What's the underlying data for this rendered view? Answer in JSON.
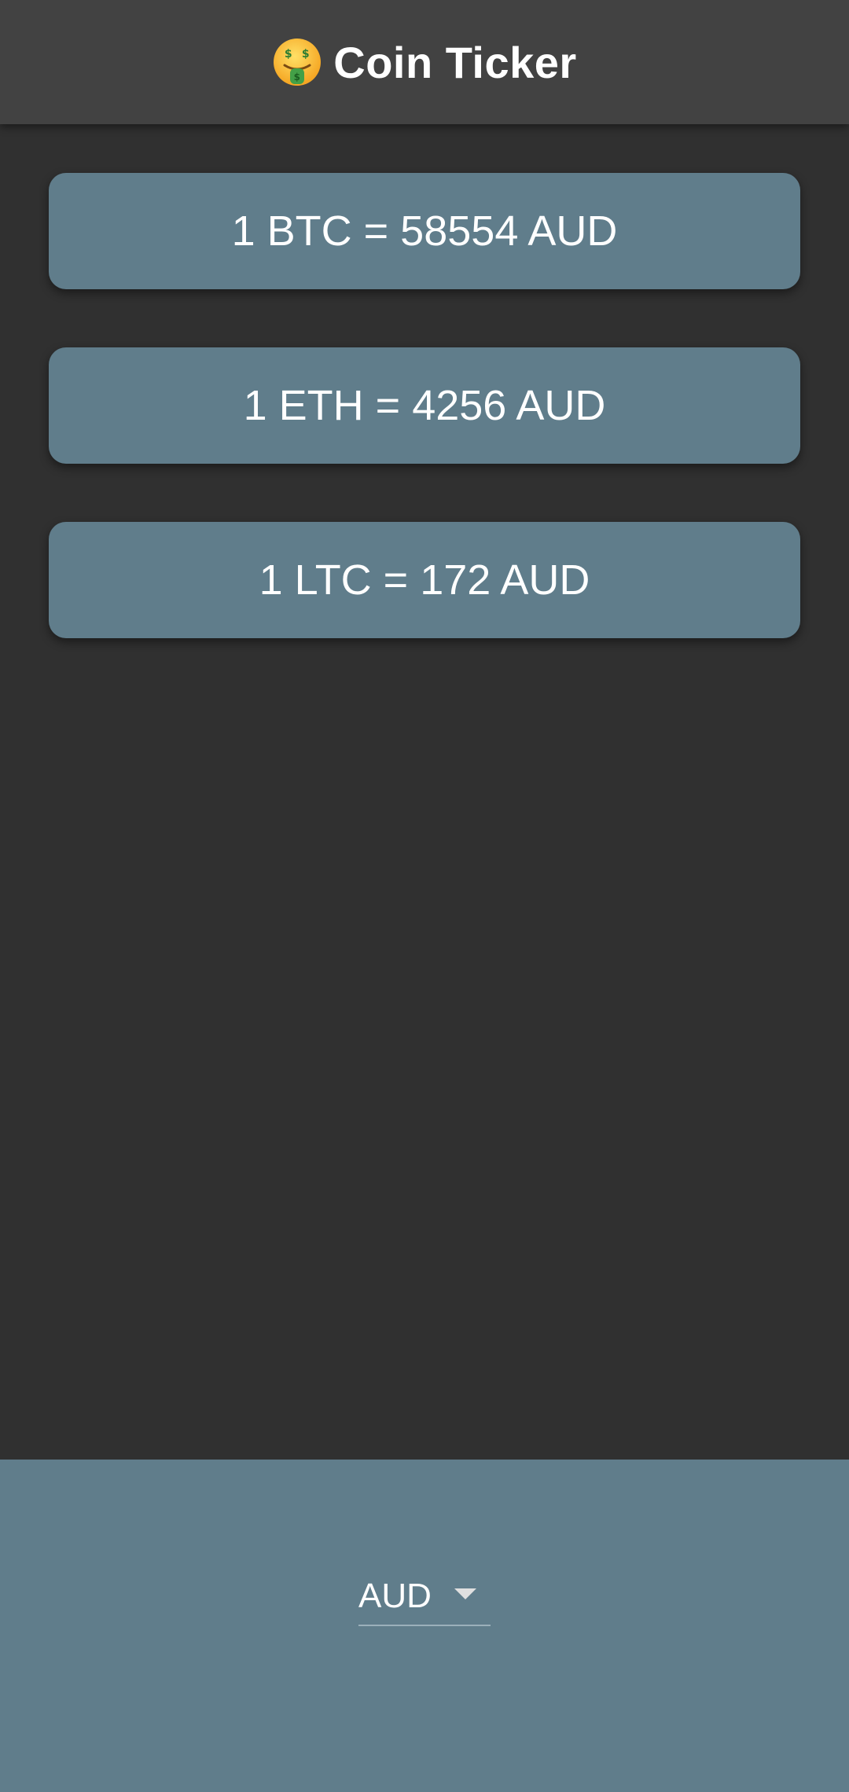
{
  "app_bar": {
    "emoji_icon": "money-mouth-face-icon",
    "title": "Coin Ticker"
  },
  "rates": [
    {
      "text": "1 BTC = 58554 AUD"
    },
    {
      "text": "1 ETH = 4256 AUD"
    },
    {
      "text": "1 LTC = 172 AUD"
    }
  ],
  "currency_picker": {
    "selected": "AUD"
  },
  "colors": {
    "background": "#303030",
    "app_bar": "#424242",
    "card": "#607d8b",
    "bottom_panel": "#607d8b"
  }
}
